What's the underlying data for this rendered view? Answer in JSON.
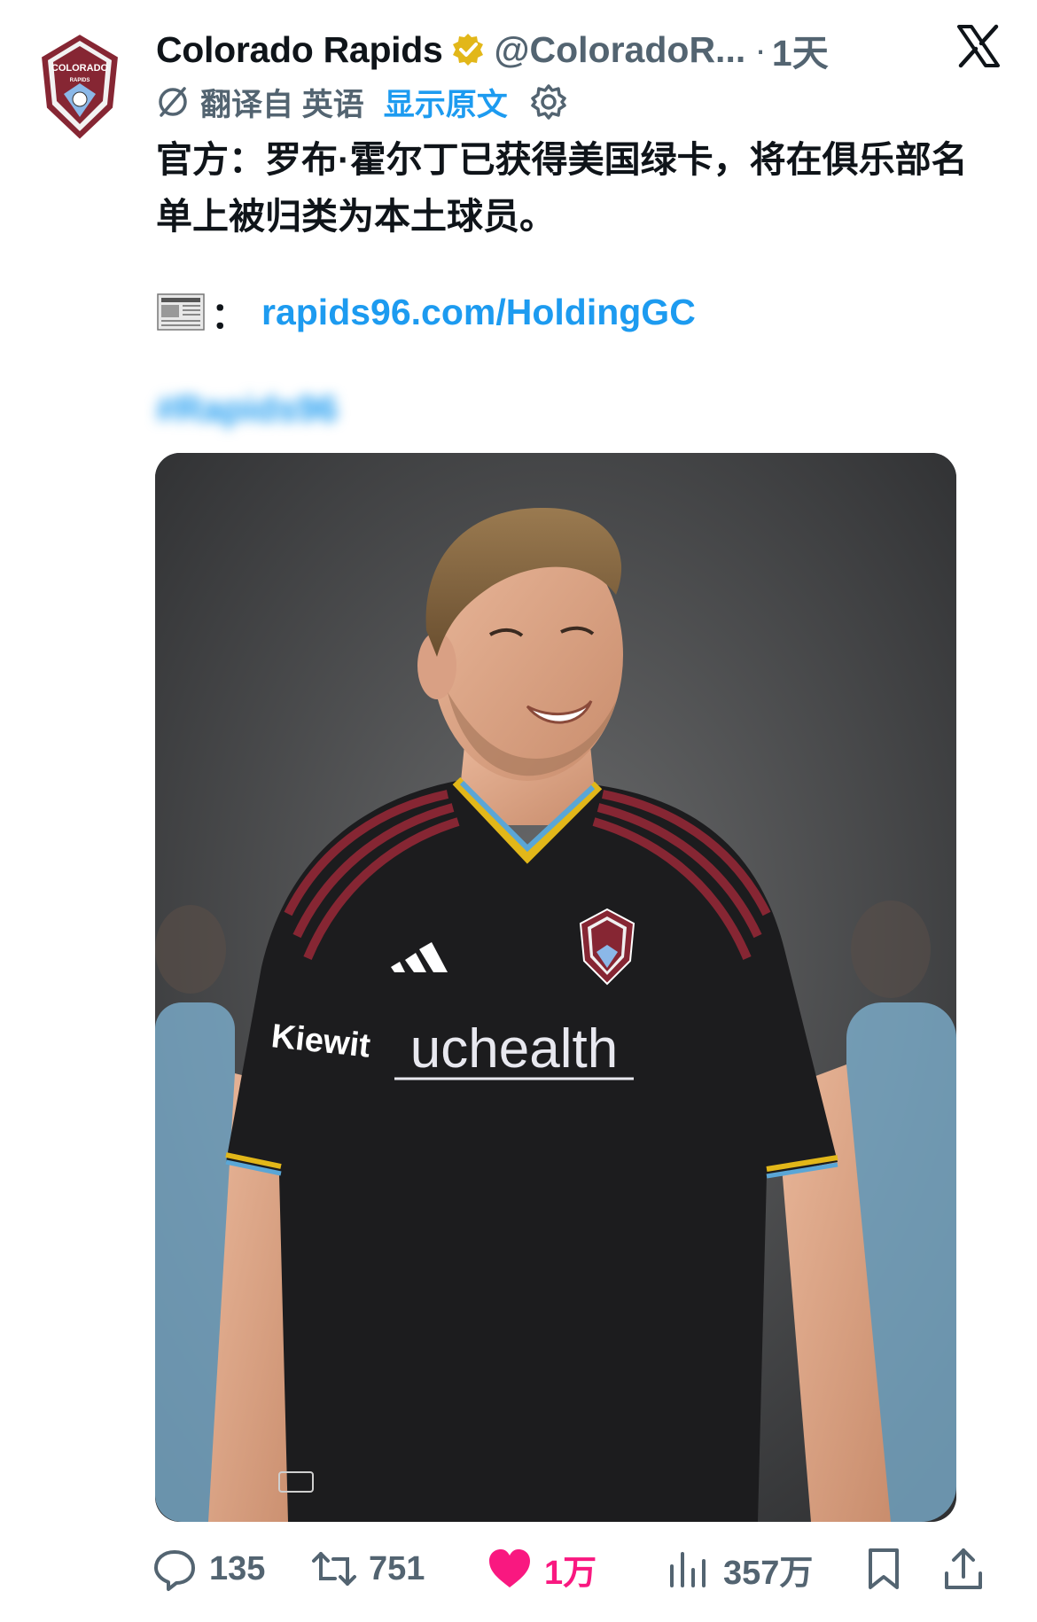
{
  "author": {
    "name": "Colorado Rapids",
    "handle": "@ColoradoR...",
    "time": "1天",
    "logo_text": "COLORADO",
    "logo_subtext": "RAPIDS"
  },
  "translation": {
    "label": "翻译自 英语",
    "show_original": "显示原文"
  },
  "tweet": {
    "text": "官方：罗布·霍尔丁已获得美国绿卡，将在俱乐部名单上被归类为本土球员。",
    "colon": "：",
    "link": "rapids96.com/HoldingGC",
    "hashtag": "#Rapids96"
  },
  "media": {
    "jersey_sponsor": "uchealth",
    "sleeve_sponsor": "Kiewit"
  },
  "actions": {
    "replies": "135",
    "retweets": "751",
    "likes": "1万",
    "views": "357万"
  },
  "colors": {
    "link_blue": "#1d9bf0",
    "like_pink": "#f91880",
    "muted": "#536471",
    "verified_gold": "#e2b719",
    "club_burgundy": "#862633"
  },
  "icons": [
    "verified-badge-icon",
    "x-logo-icon",
    "translate-icon",
    "settings-gear-icon",
    "newspaper-icon",
    "reply-icon",
    "retweet-icon",
    "like-heart-icon",
    "views-chart-icon",
    "bookmark-icon",
    "share-icon"
  ]
}
